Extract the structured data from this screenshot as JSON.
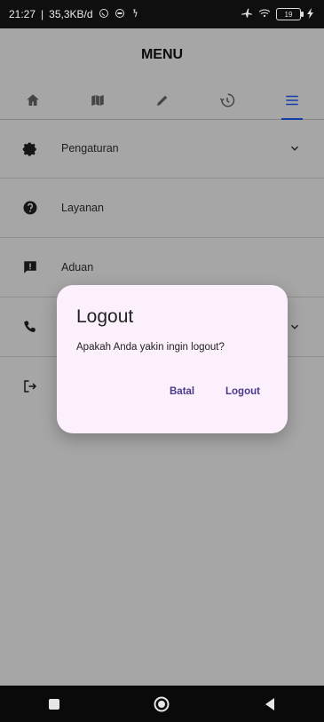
{
  "statusbar": {
    "time": "21:27",
    "speed": "35,3KB/d",
    "battery": "19"
  },
  "appbar": {
    "title": "MENU"
  },
  "tabs": [
    {
      "icon": "home-icon"
    },
    {
      "icon": "map-icon"
    },
    {
      "icon": "pencil-icon"
    },
    {
      "icon": "history-icon"
    },
    {
      "icon": "menu-icon"
    }
  ],
  "menu": {
    "items": [
      {
        "label": "Pengaturan",
        "icon": "gear-icon",
        "has_chevron": true
      },
      {
        "label": "Layanan",
        "icon": "question-icon",
        "has_chevron": false
      },
      {
        "label": "Aduan",
        "icon": "feedback-icon",
        "has_chevron": false
      },
      {
        "label": "",
        "icon": "phone-icon",
        "has_chevron": true
      },
      {
        "label": "",
        "icon": "logout-icon",
        "has_chevron": false
      }
    ]
  },
  "dialog": {
    "title": "Logout",
    "message": "Apakah Anda yakin ingin logout?",
    "cancel_label": "Batal",
    "confirm_label": "Logout"
  },
  "colors": {
    "accent": "#1f5eff",
    "dialog_button": "#4a3a8a",
    "dialog_bg": "#fbf0fb"
  }
}
